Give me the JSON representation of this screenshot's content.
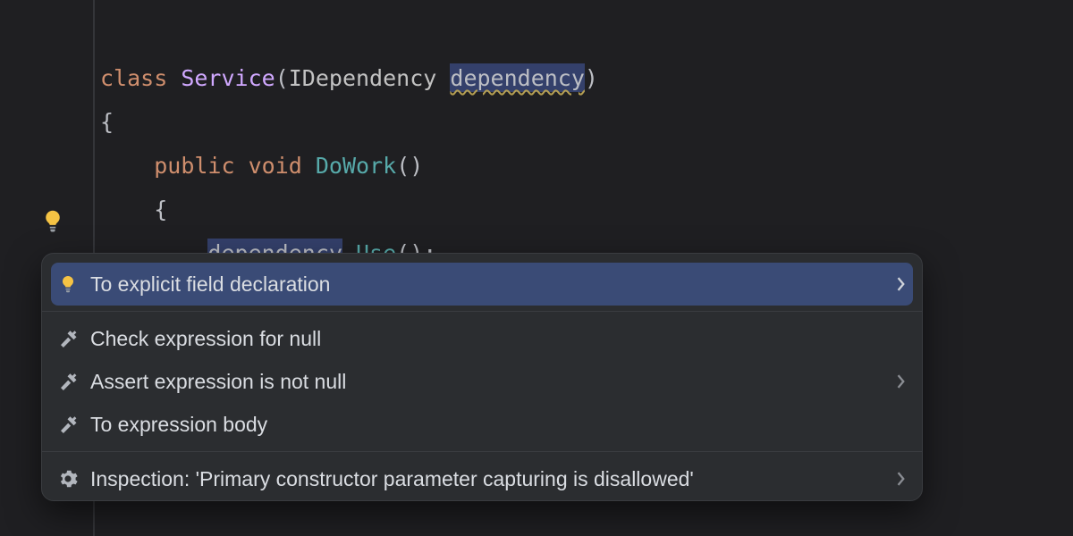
{
  "code": {
    "l1": {
      "kw": "class",
      "type": "Service",
      "iface": "IDependency",
      "param": "dependency"
    },
    "l2": "{",
    "l3": {
      "mod": "public",
      "ret": "void",
      "name": "DoWork"
    },
    "l4": "{",
    "l5": {
      "obj": "dependency",
      "call": "Use"
    }
  },
  "menu": {
    "items": [
      {
        "icon": "bulb",
        "label": "To explicit field declaration",
        "arrow": true,
        "selected": true
      },
      {
        "sep": true
      },
      {
        "icon": "hammer",
        "label": "Check expression for null"
      },
      {
        "icon": "hammer",
        "label": "Assert expression is not null",
        "arrow": true
      },
      {
        "icon": "hammer",
        "label": "To expression body"
      },
      {
        "sep": true
      },
      {
        "icon": "gear",
        "label": "Inspection: 'Primary constructor parameter capturing is disallowed'",
        "arrow": true
      }
    ]
  }
}
